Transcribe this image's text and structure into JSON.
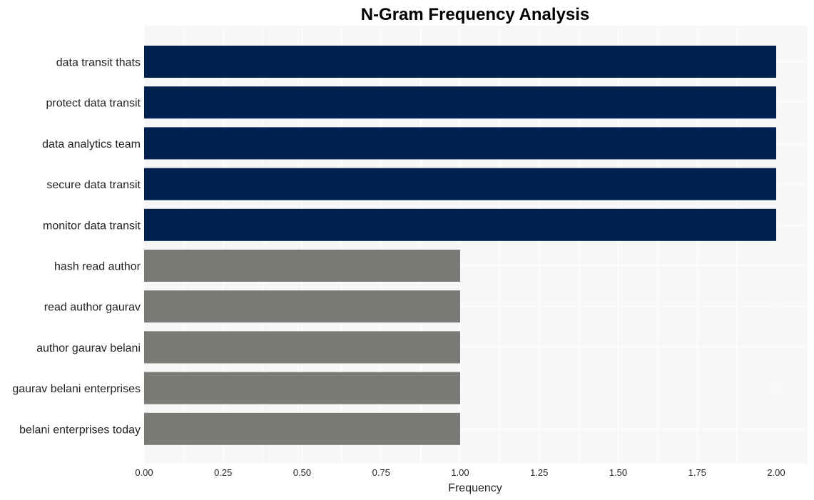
{
  "chart_data": {
    "type": "bar",
    "orientation": "horizontal",
    "title": "N-Gram Frequency Analysis",
    "xlabel": "Frequency",
    "ylabel": "",
    "xlim": [
      0,
      2.1
    ],
    "grid": true,
    "xticks": [
      "0.00",
      "0.25",
      "0.50",
      "0.75",
      "1.00",
      "1.25",
      "1.50",
      "1.75",
      "2.00"
    ],
    "xtick_values": [
      0,
      0.25,
      0.5,
      0.75,
      1.0,
      1.25,
      1.5,
      1.75,
      2.0
    ],
    "categories": [
      "data transit thats",
      "protect data transit",
      "data analytics team",
      "secure data transit",
      "monitor data transit",
      "hash read author",
      "read author gaurav",
      "author gaurav belani",
      "gaurav belani enterprises",
      "belani enterprises today"
    ],
    "values": [
      2,
      2,
      2,
      2,
      2,
      1,
      1,
      1,
      1,
      1
    ],
    "colors": {
      "high": "#00204f",
      "low": "#7b7a76",
      "plot_background": "#f7f7f7",
      "grid": "#ffffff"
    }
  }
}
